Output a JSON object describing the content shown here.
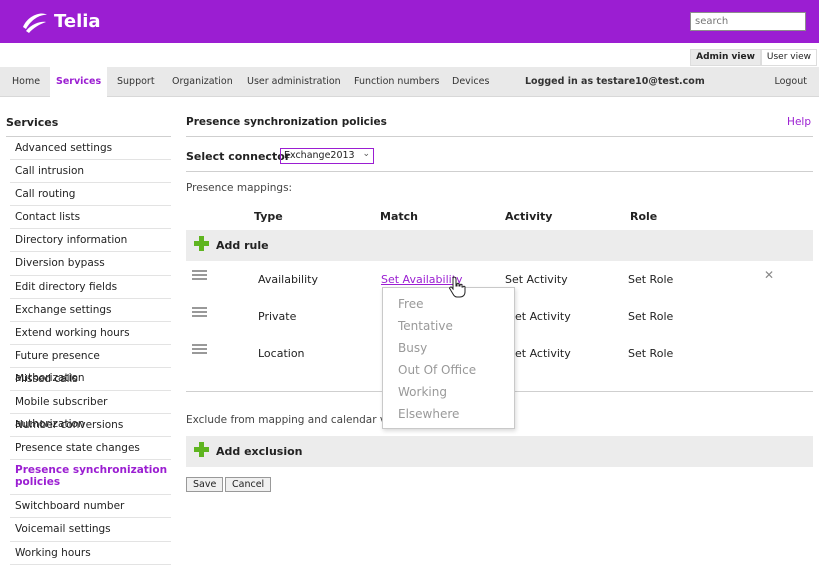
{
  "header": {
    "brand": "Telia",
    "search_placeholder": "search"
  },
  "view_tabs": [
    "Admin view",
    "User view"
  ],
  "nav": {
    "items": [
      "Home",
      "Services",
      "Support",
      "Organization",
      "User administration",
      "Function numbers",
      "Devices"
    ],
    "active": "Services",
    "logged_in": "Logged in as testare10@test.com",
    "logout": "Logout"
  },
  "sidebar": {
    "title": "Services",
    "items": [
      "Advanced settings",
      "Call intrusion",
      "Call routing",
      "Contact lists",
      "Directory information",
      "Diversion bypass",
      "Edit directory fields",
      "Exchange settings",
      "Extend working hours",
      "Future presence authorization",
      "Missed calls",
      "Mobile subscriber authorization",
      "Number conversions",
      "Presence state changes",
      "Presence synchronization policies",
      "Switchboard number",
      "Voicemail settings",
      "Working hours"
    ],
    "active_item": "Presence synchronization policies"
  },
  "main": {
    "title": "Presence synchronization policies",
    "help": "Help",
    "select_label": "Select connector",
    "connector_value": "Exchange2013",
    "mappings_label": "Presence mappings:",
    "columns": [
      "Type",
      "Match",
      "Activity",
      "Role"
    ],
    "add_rule": "Add rule",
    "rows": [
      {
        "type": "Availability",
        "match": "Set Availability",
        "activity": "Set Activity",
        "role": "Set Role"
      },
      {
        "type": "Private",
        "match": "",
        "activity": "et Activity",
        "role": "Set Role"
      },
      {
        "type": "Location",
        "match": "",
        "activity": "et Activity",
        "role": "Set Role"
      }
    ],
    "dropdown_options": [
      "Free",
      "Tentative",
      "Busy",
      "Out Of Office",
      "Working",
      "Elsewhere"
    ],
    "exclude_label": "Exclude from mapping and calendar vie",
    "add_exclusion": "Add exclusion",
    "save": "Save",
    "cancel": "Cancel"
  },
  "colors": {
    "brand_purple": "#9b1ed2",
    "plus_green": "#5fb520"
  }
}
